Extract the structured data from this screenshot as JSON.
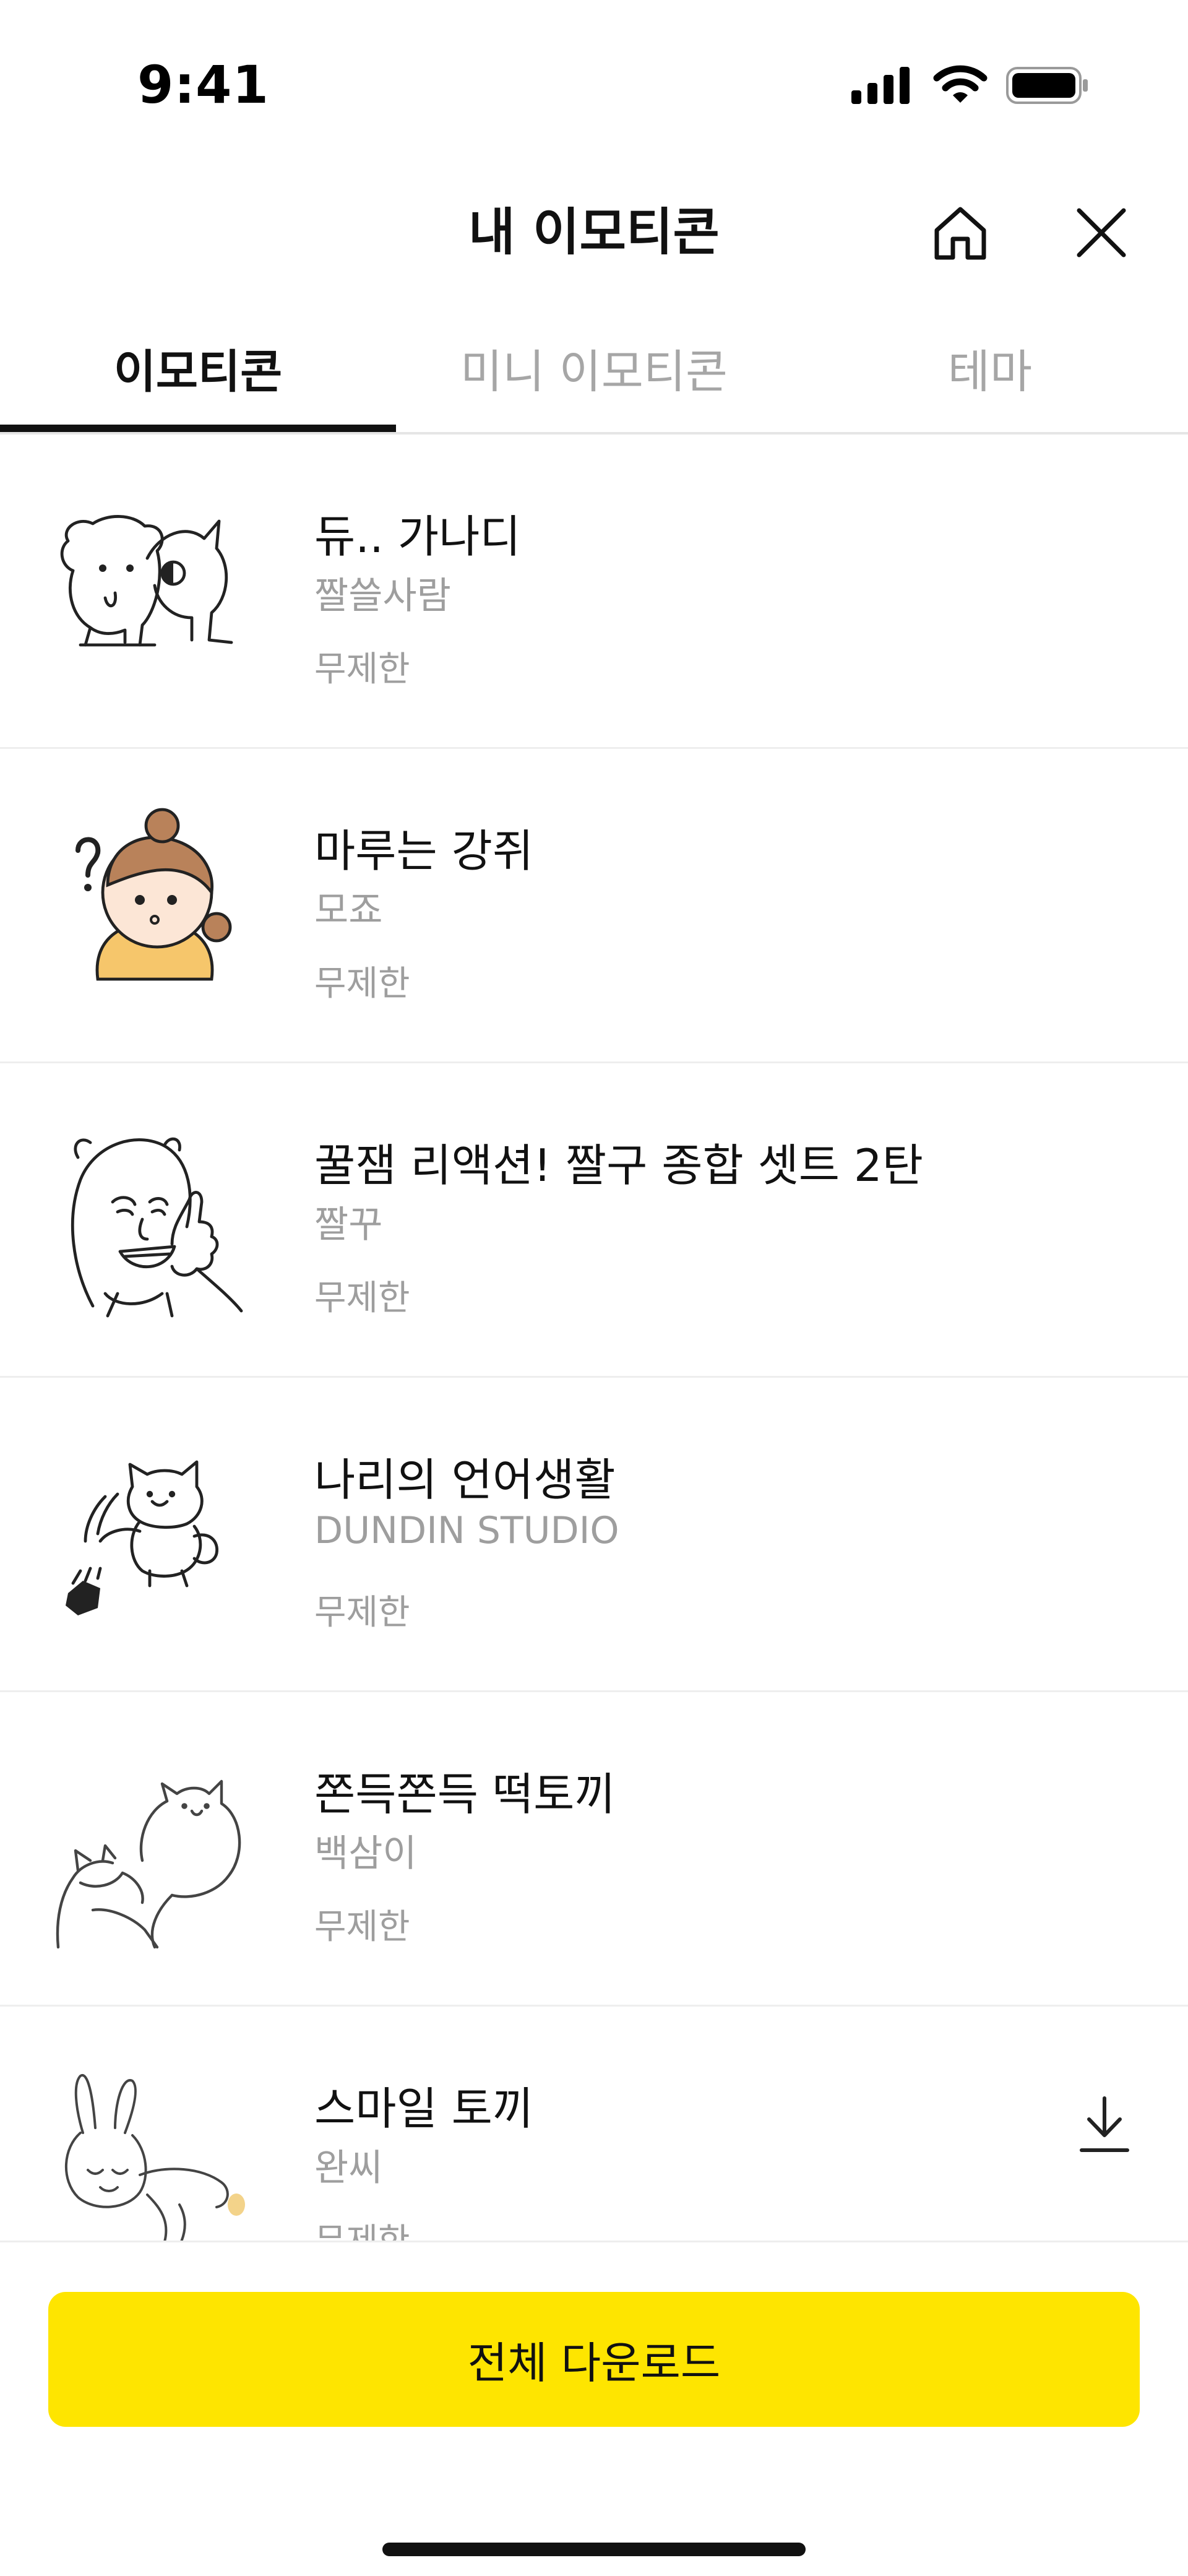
{
  "status_bar": {
    "time": "9:41",
    "icons": [
      "signal-icon",
      "wifi-icon",
      "battery-icon"
    ]
  },
  "header": {
    "title": "내 이모티콘",
    "icons": [
      "home-icon",
      "close-icon"
    ]
  },
  "tabs": [
    {
      "label": "이모티콘",
      "active": true
    },
    {
      "label": "미니 이모티콘",
      "active": false
    },
    {
      "label": "테마",
      "active": false
    }
  ],
  "emoticons": [
    {
      "title": "듀.. 가나디",
      "author": "짤쓸사람",
      "duration": "무제한"
    },
    {
      "title": "마루는 강쥐",
      "author": "모죠",
      "duration": "무제한"
    },
    {
      "title": "꿀잼 리액션! 짤구 종합 셋트 2탄",
      "author": "짤꾸",
      "duration": "무제한"
    },
    {
      "title": "나리의 언어생활",
      "author": "DUNDIN STUDIO",
      "duration": "무제한"
    },
    {
      "title": "쫀득쫀득 떡토끼",
      "author": "백삼이",
      "duration": "무제한"
    },
    {
      "title": "스마일 토끼",
      "author": "완씨",
      "duration": "무제한",
      "action_icon": "download-icon"
    }
  ],
  "footer": {
    "download_all_label": "전체 다운로드"
  },
  "colors": {
    "accent": "#FEE500",
    "text_primary": "#111111",
    "text_secondary": "#9E9E9E",
    "divider": "#EEEEEE"
  }
}
